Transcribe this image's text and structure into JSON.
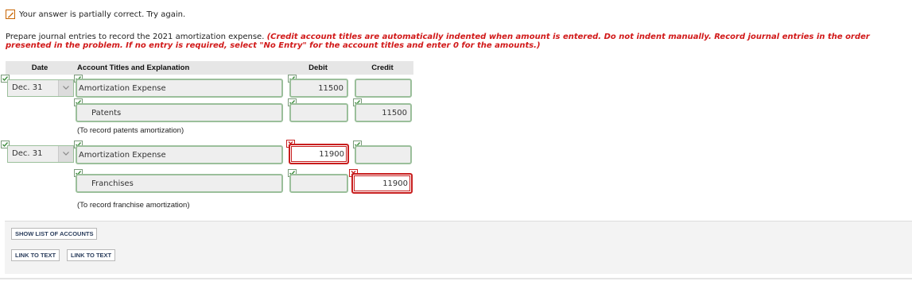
{
  "status": {
    "text": "Your answer is partially correct.  Try again."
  },
  "instructions": {
    "prefix": "Prepare journal entries to record the 2021 amortization expense. ",
    "note": "(Credit account titles are automatically indented when amount is entered. Do not indent manually. Record journal entries in the order presented in the problem. If no entry is required, select \"No Entry\" for the account titles and enter 0 for the amounts.)"
  },
  "table": {
    "headers": {
      "date": "Date",
      "account": "Account Titles and Explanation",
      "debit": "Debit",
      "credit": "Credit"
    },
    "entry1": {
      "date": "Dec. 31",
      "row1": {
        "account": "Amortization Expense",
        "debit": "11500",
        "credit": ""
      },
      "row2": {
        "account": "Patents",
        "debit": "",
        "credit": "11500"
      },
      "note": "(To record patents amortization)"
    },
    "entry2": {
      "date": "Dec. 31",
      "row1": {
        "account": "Amortization Expense",
        "debit": "11900",
        "credit": ""
      },
      "row2": {
        "account": "Franchises",
        "debit": "",
        "credit": "11900"
      },
      "note": "(To record franchise amortization)"
    }
  },
  "buttons": {
    "show_accounts": "SHOW LIST OF ACCOUNTS",
    "link1": "LINK TO TEXT",
    "link2": "LINK TO TEXT"
  },
  "colors": {
    "correct": "#7a9a7a",
    "incorrect": "#c81e1e",
    "instruction_red": "#d11919"
  }
}
